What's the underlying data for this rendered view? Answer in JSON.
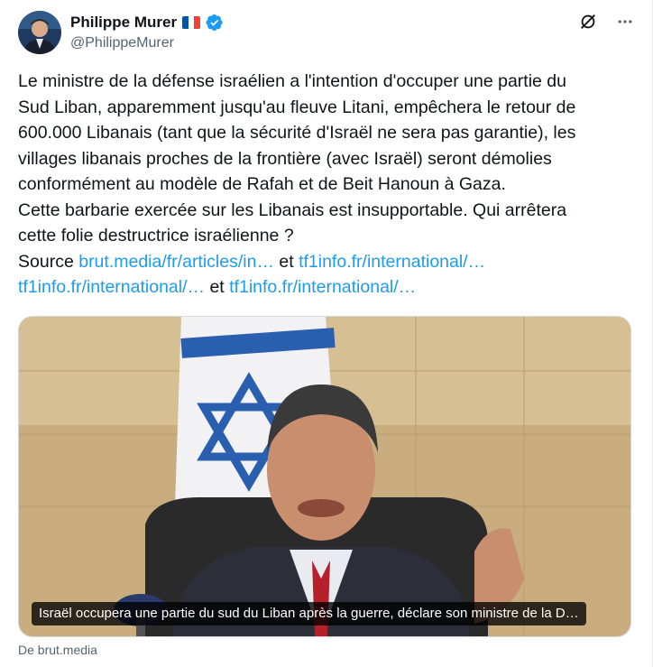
{
  "author": {
    "display_name": "Philippe Murer",
    "flag_emoji": "🇫🇷",
    "handle": "@PhilippeMurer",
    "verified_color": "#1d9bf0"
  },
  "header_icons": [
    "grok-icon",
    "more-icon"
  ],
  "tweet": {
    "lines": [
      "Le ministre de la défense israélien a l'intention d'occuper une partie du",
      "Sud Liban, apparemment jusqu'au fleuve Litani, empêchera le retour de",
      "600.000 Libanais (tant que la sécurité d'Israël ne sera pas garantie), les",
      "villages libanais proches de la frontière (avec Israël) seront démolies",
      "conformément au modèle de Rafah et de Beit Hanoun à Gaza.",
      "Cette barbarie exercée sur les Libanais est insupportable. Qui arrêtera",
      "cette folie destructrice israélienne ?"
    ],
    "source_label": "Source",
    "link1": "brut.media/fr/articles/in…",
    "and1": "et",
    "link2": "tf1info.fr/international/…",
    "link3": "tf1info.fr/international/…",
    "and2": "et",
    "link4": "tf1info.fr/international/…"
  },
  "card": {
    "caption": "Israël occupera une partie du sud du Liban après la guerre, déclare son ministre de la D…",
    "source": "De brut.media"
  },
  "colors": {
    "link": "#1d9bf0",
    "text": "#0f1419",
    "secondary": "#536471"
  }
}
